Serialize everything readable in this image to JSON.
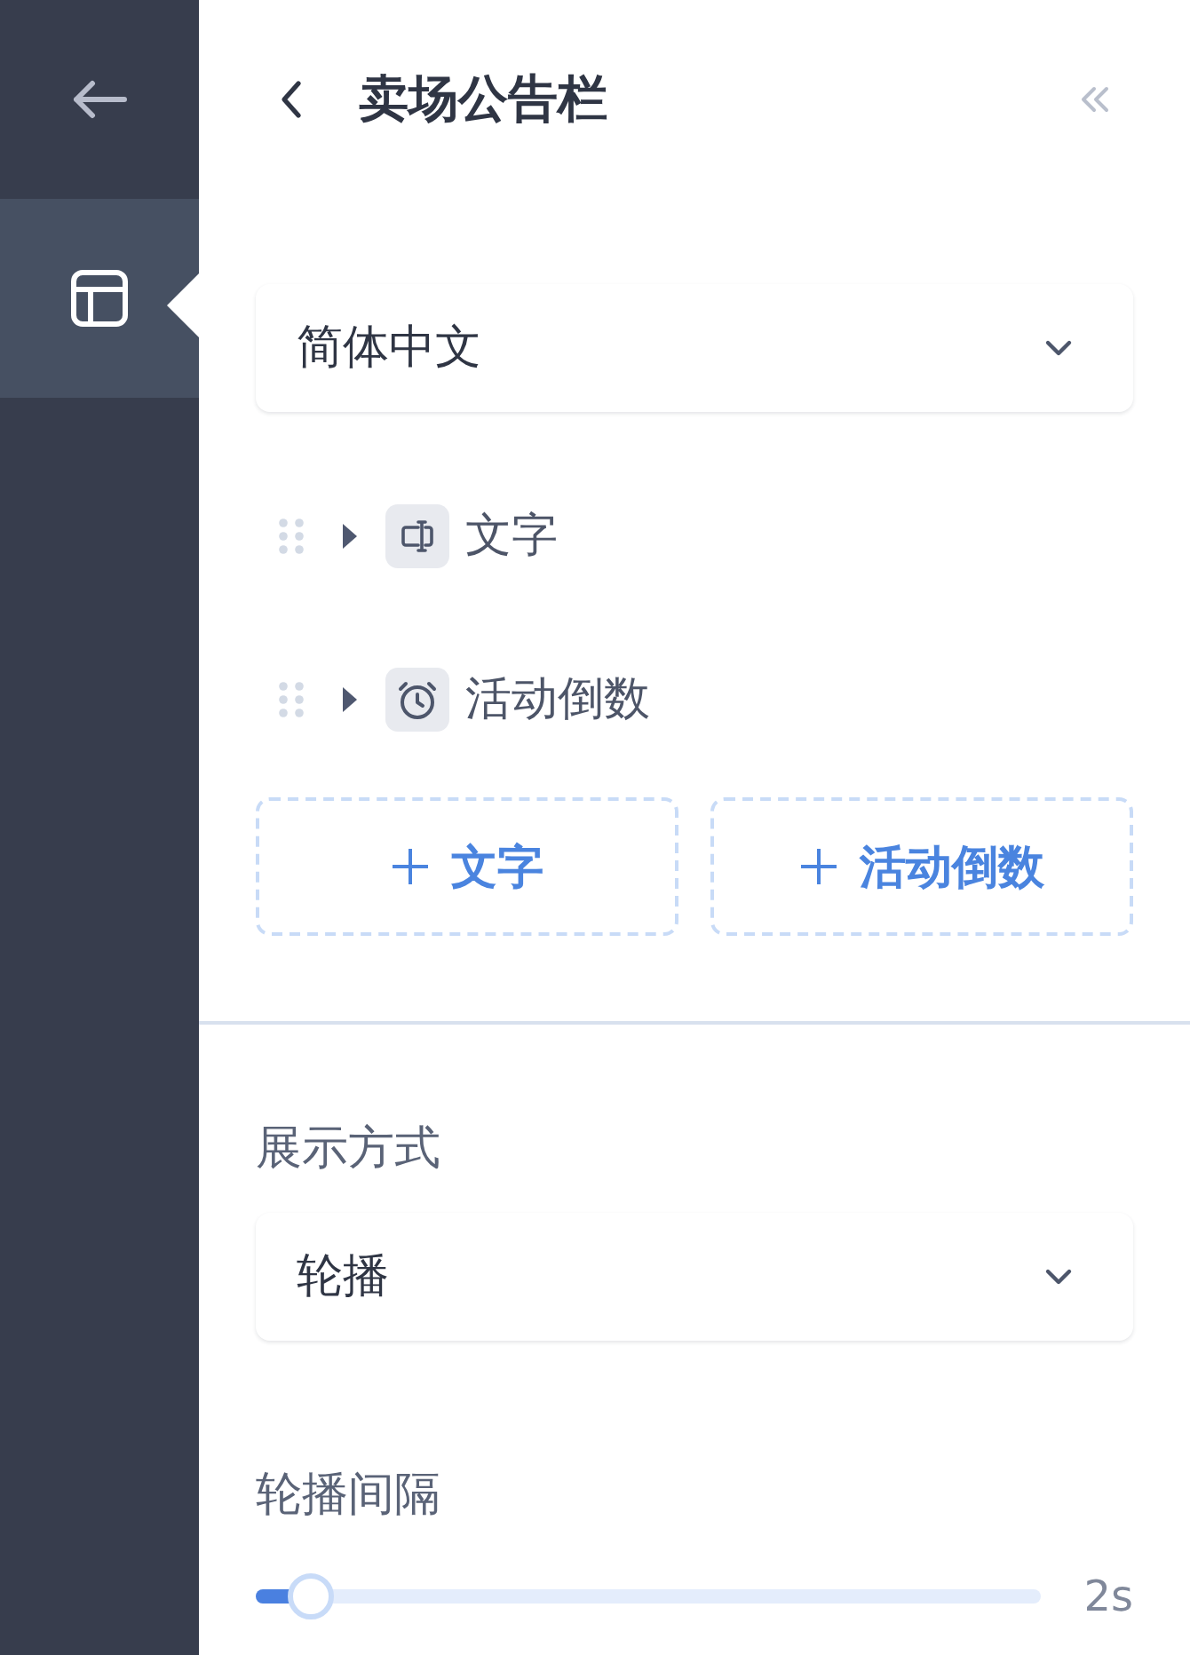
{
  "rail": {
    "items": [
      {
        "kind": "back",
        "selected": false
      },
      {
        "kind": "layout",
        "selected": true
      }
    ]
  },
  "header": {
    "title": "卖场公告栏"
  },
  "language_select": {
    "value": "简体中文"
  },
  "elements": [
    {
      "kind": "text",
      "label": "文字",
      "expanded": false
    },
    {
      "kind": "countdown",
      "label": "活动倒数",
      "expanded": false
    }
  ],
  "add_buttons": [
    {
      "label": "文字"
    },
    {
      "label": "活动倒数"
    }
  ],
  "display_mode": {
    "label": "展示方式",
    "value": "轮播"
  },
  "interval": {
    "label": "轮播间隔",
    "level": 0.07,
    "reading": "2s"
  }
}
